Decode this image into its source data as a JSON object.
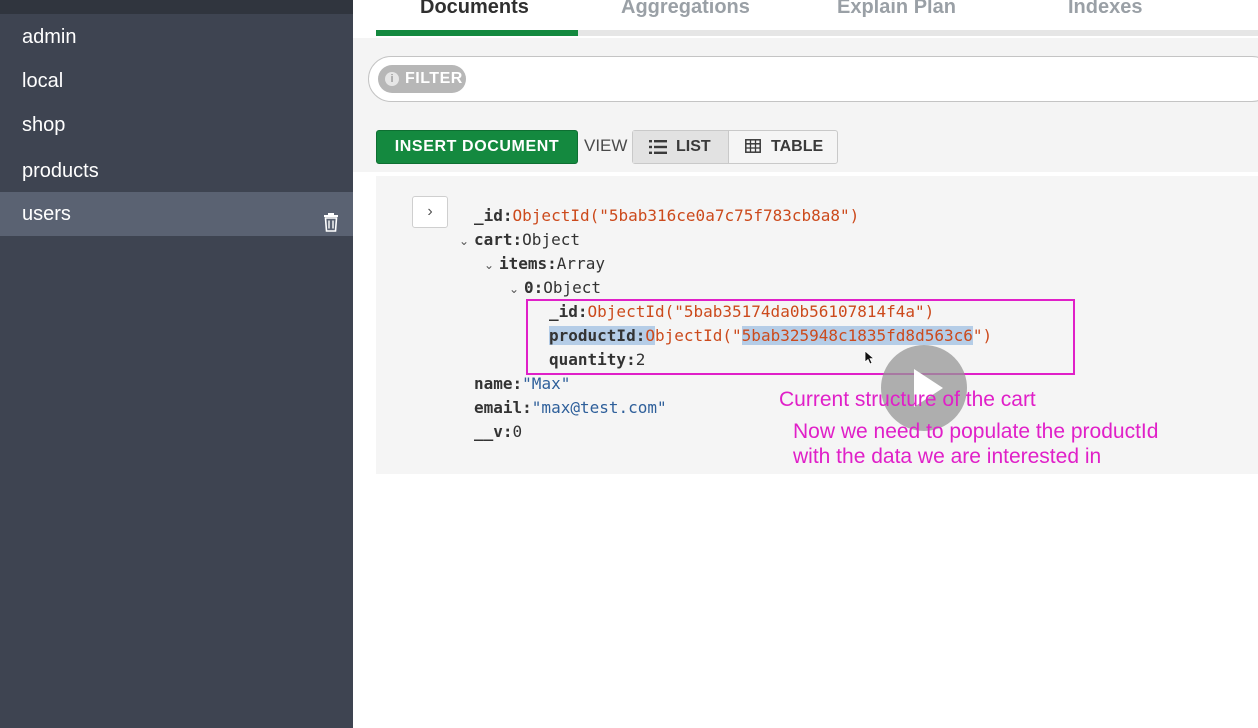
{
  "sidebar": {
    "items": [
      {
        "label": "admin"
      },
      {
        "label": "local"
      },
      {
        "label": "shop"
      },
      {
        "label": "products"
      },
      {
        "label": "users",
        "active": true
      }
    ]
  },
  "tabs": [
    {
      "label": "Documents",
      "active": true
    },
    {
      "label": "Aggregations"
    },
    {
      "label": "Explain Plan"
    },
    {
      "label": "Indexes"
    }
  ],
  "filter": {
    "badge": "FILTER",
    "info_icon": "i"
  },
  "toolbar": {
    "insert_label": "INSERT DOCUMENT",
    "view_label": "VIEW",
    "list_label": "LIST",
    "table_label": "TABLE"
  },
  "document": {
    "expand_icon": "›",
    "id_key": "_id:",
    "id_value": "ObjectId(\"5bab316ce0a7c75f783cb8a8\")",
    "cart_key": "cart:",
    "cart_type": "Object",
    "items_key": "items:",
    "items_type": "Array",
    "item0_key": "0:",
    "item0_type": "Object",
    "item_id_key": "_id:",
    "item_id_value": "ObjectId(\"5bab35174da0b56107814f4a\")",
    "productid_key": "productId:",
    "productid_prefix": "O",
    "productid_mid": "bjectId(\"",
    "productid_hex": "5bab325948c1835fd8d563c6",
    "productid_suffix": "\")",
    "quantity_key": "quantity:",
    "quantity_value": "2",
    "name_key": "name:",
    "name_value": "\"Max\"",
    "email_key": "email:",
    "email_value": "\"max@test.com\"",
    "v_key": "__v:",
    "v_value": "0"
  },
  "annotations": {
    "line1": "Current structure of the cart",
    "line2": "Now we need to populate the productId",
    "line3": "with the data we are interested in",
    "color": "#e020c8"
  },
  "colors": {
    "sidebar_bg": "#3e4451",
    "accent_green": "#14893f",
    "objectid": "#cc4a1c",
    "string": "#2e5f9a"
  }
}
